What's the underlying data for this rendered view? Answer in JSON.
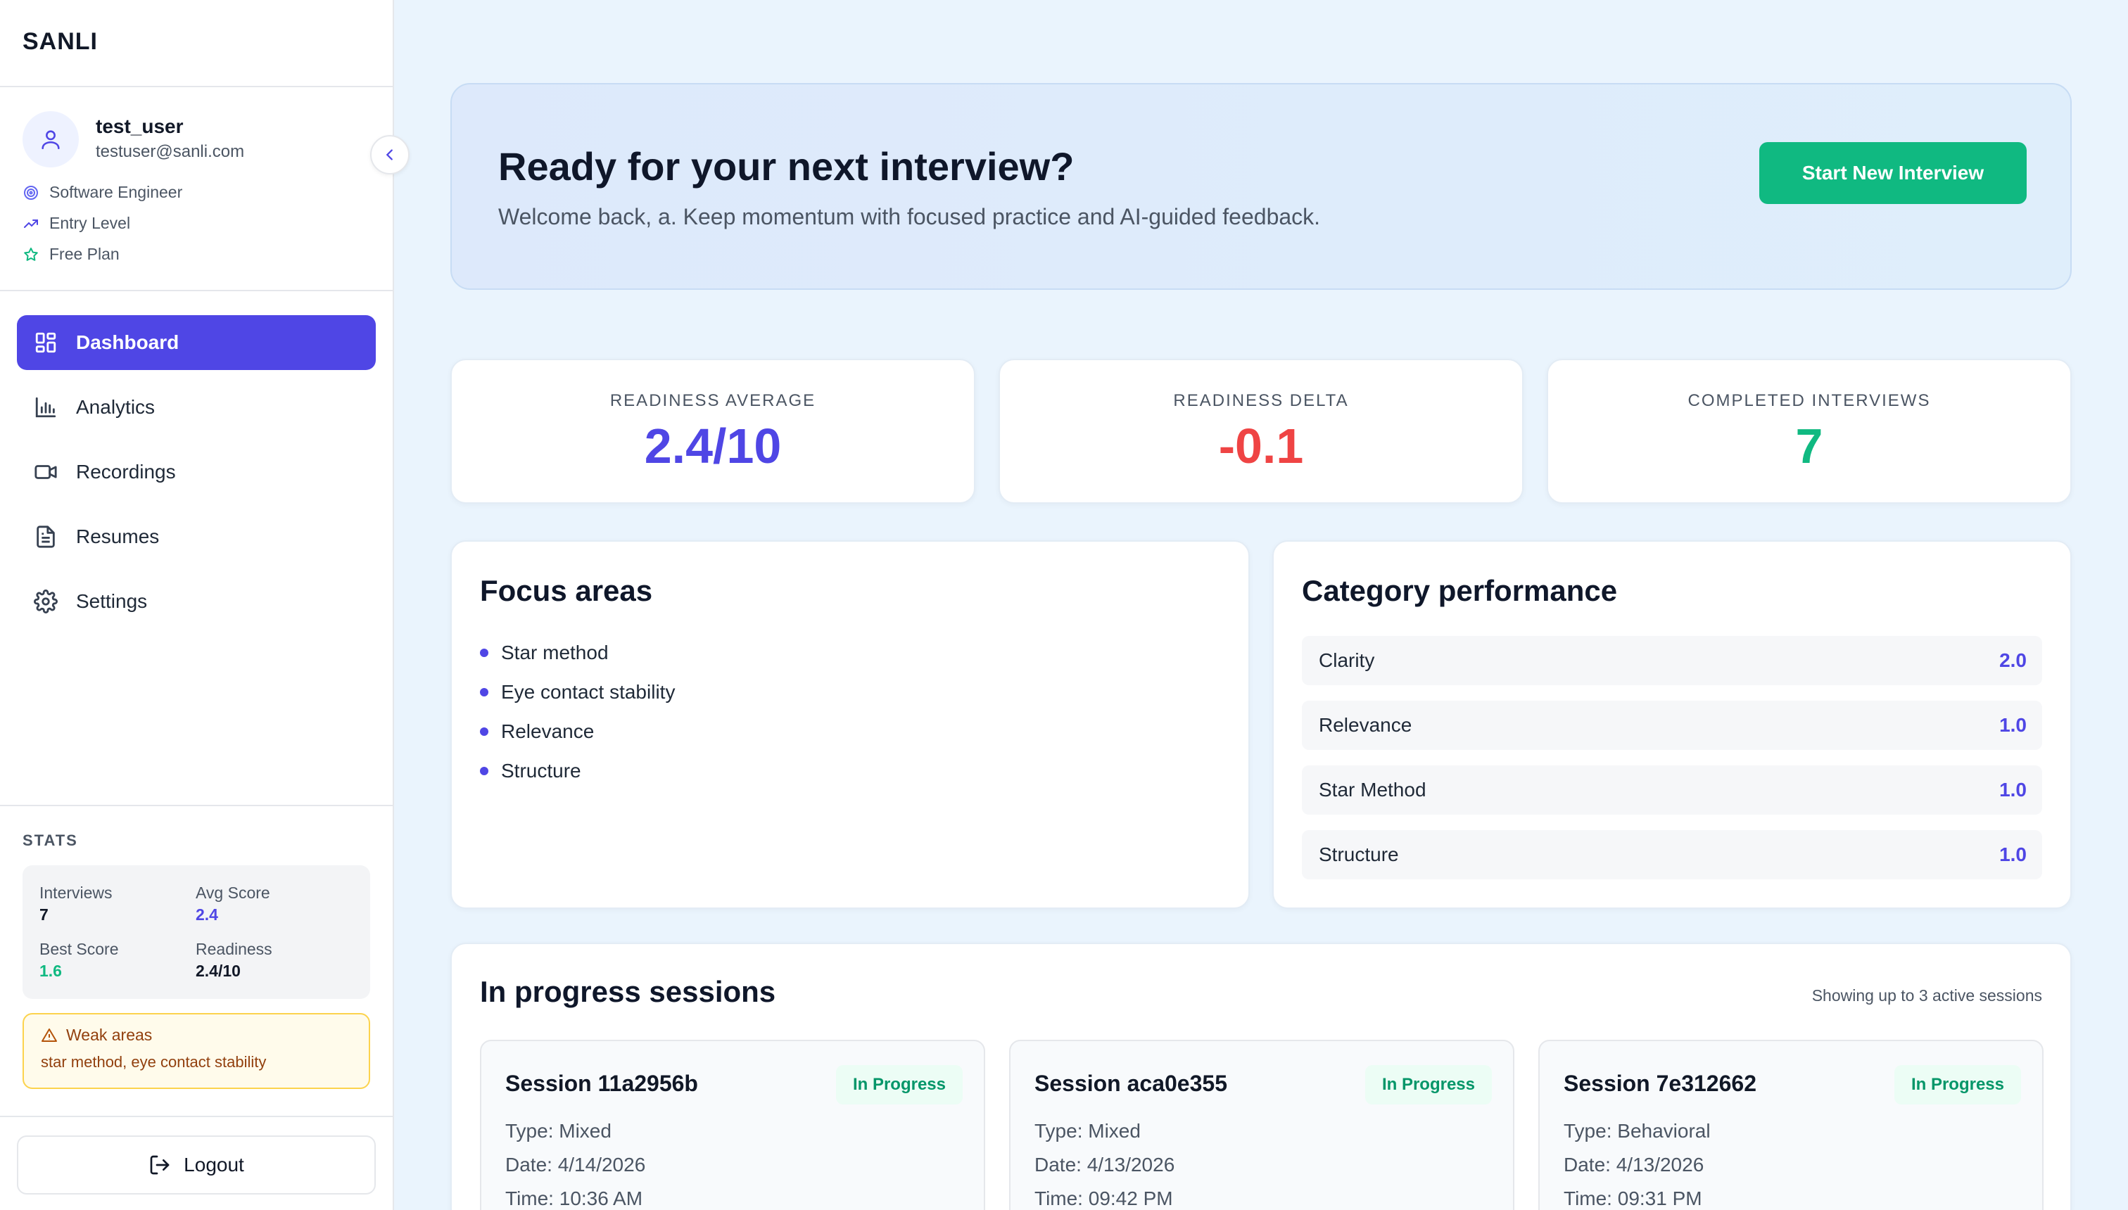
{
  "app": {
    "brand": "SANLI"
  },
  "user": {
    "name": "test_user",
    "email": "testuser@sanli.com",
    "role": "Software Engineer",
    "level": "Entry Level",
    "plan": "Free Plan"
  },
  "nav": [
    {
      "label": "Dashboard",
      "icon": "dashboard-icon",
      "active": true
    },
    {
      "label": "Analytics",
      "icon": "bar-chart-icon",
      "active": false
    },
    {
      "label": "Recordings",
      "icon": "video-icon",
      "active": false
    },
    {
      "label": "Resumes",
      "icon": "document-icon",
      "active": false
    },
    {
      "label": "Settings",
      "icon": "gear-icon",
      "active": false
    }
  ],
  "stats": {
    "title": "STATS",
    "interviews_label": "Interviews",
    "interviews_value": "7",
    "avg_label": "Avg Score",
    "avg_value": "2.4",
    "best_label": "Best Score",
    "best_value": "1.6",
    "readiness_label": "Readiness",
    "readiness_value": "2.4/10"
  },
  "weak": {
    "title": "Weak areas",
    "text": "star method, eye contact stability"
  },
  "logout_label": "Logout",
  "hero": {
    "title": "Ready for your next interview?",
    "subtitle": "Welcome back, a. Keep momentum with focused practice and AI-guided feedback.",
    "button": "Start New Interview"
  },
  "kpis": [
    {
      "label": "READINESS AVERAGE",
      "value": "2.4/10",
      "color": "#4f46e5"
    },
    {
      "label": "READINESS DELTA",
      "value": "-0.1",
      "color": "#ef4444"
    },
    {
      "label": "COMPLETED INTERVIEWS",
      "value": "7",
      "color": "#10b981"
    }
  ],
  "focus": {
    "title": "Focus areas",
    "items": [
      "Star method",
      "Eye contact stability",
      "Relevance",
      "Structure"
    ]
  },
  "category": {
    "title": "Category performance",
    "rows": [
      {
        "label": "Clarity",
        "value": "2.0"
      },
      {
        "label": "Relevance",
        "value": "1.0"
      },
      {
        "label": "Star Method",
        "value": "1.0"
      },
      {
        "label": "Structure",
        "value": "1.0"
      }
    ]
  },
  "sessions": {
    "title": "In progress sessions",
    "note": "Showing up to 3 active sessions",
    "items": [
      {
        "title": "Session 11a2956b",
        "status": "In Progress",
        "type": "Type: Mixed",
        "date": "Date: 4/14/2026",
        "time": "Time: 10:36 AM"
      },
      {
        "title": "Session aca0e355",
        "status": "In Progress",
        "type": "Type: Mixed",
        "date": "Date: 4/13/2026",
        "time": "Time: 09:42 PM"
      },
      {
        "title": "Session 7e312662",
        "status": "In Progress",
        "type": "Type: Behavioral",
        "date": "Date: 4/13/2026",
        "time": "Time: 09:31 PM"
      }
    ]
  },
  "colors": {
    "accent": "#4f46e5",
    "success": "#10b981",
    "danger": "#ef4444"
  }
}
